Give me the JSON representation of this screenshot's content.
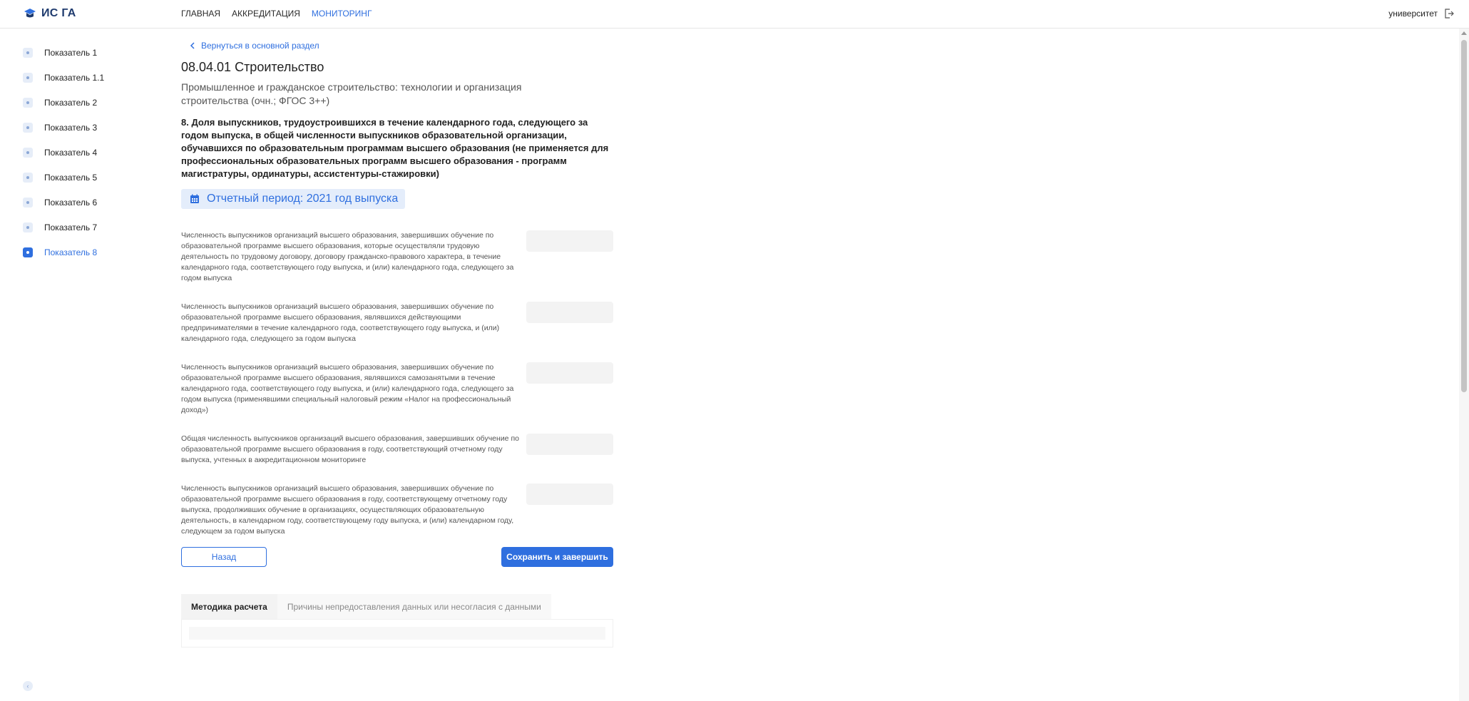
{
  "header": {
    "logo_text": "ИС ГА",
    "nav": [
      "ГЛАВНАЯ",
      "АККРЕДИТАЦИЯ",
      "МОНИТОРИНГ"
    ],
    "user": "университет",
    "accent_color": "#2f6fdf"
  },
  "sidebar": {
    "items": [
      "Показатель 1",
      "Показатель 1.1",
      "Показатель 2",
      "Показатель 3",
      "Показатель 4",
      "Показатель 5",
      "Показатель 6",
      "Показатель 7",
      "Показатель 8"
    ],
    "active": "Показатель 8"
  },
  "main": {
    "back": "Вернуться в основной раздел",
    "title": "08.04.01 Строительство",
    "program": "Промышленное и гражданское строительство: технологии и организация строительства (очн.; ФГОС 3++)",
    "indicator": "8. Доля выпускников, трудоустроившихся в течение календарного года, следующего за годом выпуска, в общей численности выпускников образовательной организации, обучавшихся по образовательным программам высшего образования (не применяется для профессиональных образовательных программ высшего образования - программ магистратуры, ординатуры, ассистентуры-стажировки)",
    "period": "Отчетный период: 2021 год выпуска",
    "fields": [
      {
        "label": "Численность выпускников организаций высшего образования, завершивших обучение по образовательной программе высшего образования, которые осуществляли трудовую деятельность по трудовому договору, договору гражданско-правового характера, в течение календарного года, соответствующего году выпуска, и (или) календарного года, следующего за годом выпуска",
        "value": ""
      },
      {
        "label": "Численность выпускников организаций высшего образования, завершивших обучение по образовательной программе высшего образования, являвшихся действующими предпринимателями в течение календарного года, соответствующего году выпуска, и (или) календарного года, следующего за годом выпуска",
        "value": ""
      },
      {
        "label": "Численность выпускников организаций высшего образования, завершивших обучение по образовательной программе высшего образования, являвшихся самозанятыми в течение календарного года, соответствующего году выпуска, и (или) календарного года, следующего за годом выпуска (применявшими специальный налоговый режим «Налог на профессиональный доход»)",
        "value": ""
      },
      {
        "label": "Общая численность выпускников организаций высшего образования, завершивших обучение по образовательной программе высшего образования в году, соответствующий отчетному году выпуска, учтенных в аккредитационном мониторинге",
        "value": ""
      },
      {
        "label": "Численность выпускников организаций высшего образования, завершивших обучение по образовательной программе высшего образования в году, соответствующему отчетному году выпуска, продолживших обучение в организациях, осуществляющих образовательную деятельность, в календарном году, соответствующему году выпуска, и (или) календарном году, следующем за годом выпуска",
        "value": ""
      }
    ],
    "back_button": "Назад",
    "save_button": "Сохранить и завершить",
    "tabs": [
      "Методика расчета",
      "Причины непредоставления данных или несогласия с данными"
    ]
  }
}
